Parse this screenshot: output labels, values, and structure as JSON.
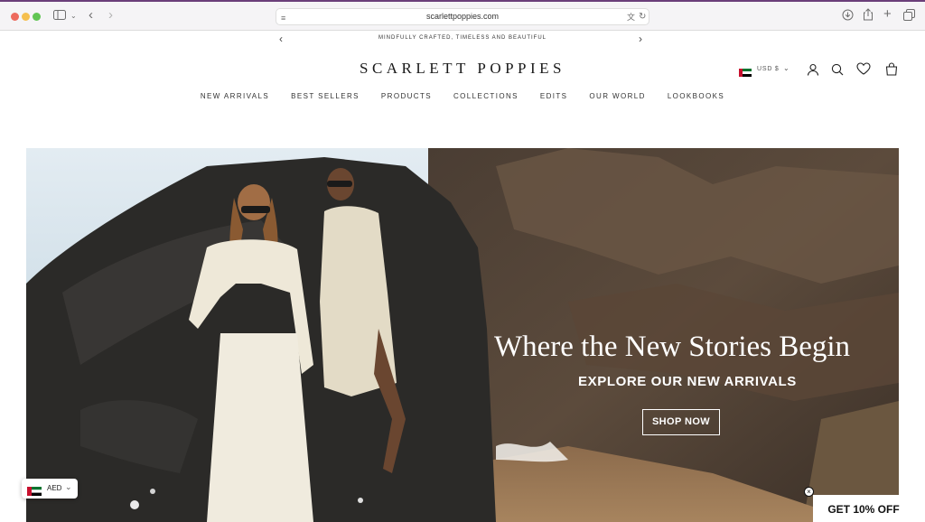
{
  "browser": {
    "url": "scarlettpoppies.com",
    "traffic_lights": [
      "#ed6a5e",
      "#f5bf4f",
      "#61c554"
    ]
  },
  "promo_bar": {
    "text": "MINDFULLY CRAFTED, TIMELESS AND BEAUTIFUL"
  },
  "header": {
    "logo": "SCARLETT POPPIES",
    "currency": "USD $"
  },
  "nav": {
    "items": [
      "NEW ARRIVALS",
      "BEST SELLERS",
      "PRODUCTS",
      "COLLECTIONS",
      "EDITS",
      "OUR WORLD",
      "LOOKBOOKS"
    ]
  },
  "hero": {
    "title": "Where the New Stories Begin",
    "subtitle": "EXPLORE OUR NEW ARRIVALS",
    "cta": "SHOP NOW"
  },
  "currency_widget": {
    "label": "AED"
  },
  "discount_tab": {
    "label": "GET 10% OFF"
  }
}
